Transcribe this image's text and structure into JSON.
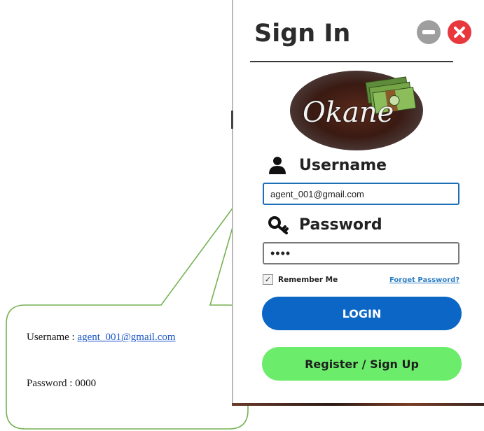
{
  "window": {
    "title": "Sign In",
    "buttons": {
      "minimize_icon": "minus-circle",
      "close_icon": "x-circle"
    }
  },
  "logo": {
    "text": "Okane"
  },
  "form": {
    "username_label": "Username",
    "username_value": "agent_001@gmail.com",
    "password_label": "Password",
    "password_value": "••••",
    "remember_me_label": "Remember Me",
    "remember_me_checked": true,
    "forgot_password_label": "Forget Password?",
    "login_label": "LOGIN",
    "register_label": "Register / Sign Up"
  },
  "callout": {
    "username_prefix": "Username : ",
    "username_link": "agent_001@gmail.com",
    "password_text": "Password : 0000"
  },
  "colors": {
    "login_button": "#0b66c5",
    "register_button": "#6bec6b",
    "close_button": "#e8383d",
    "minimize_button": "#9e9e9e",
    "callout_border": "#77b255",
    "link": "#2f7fc3"
  }
}
